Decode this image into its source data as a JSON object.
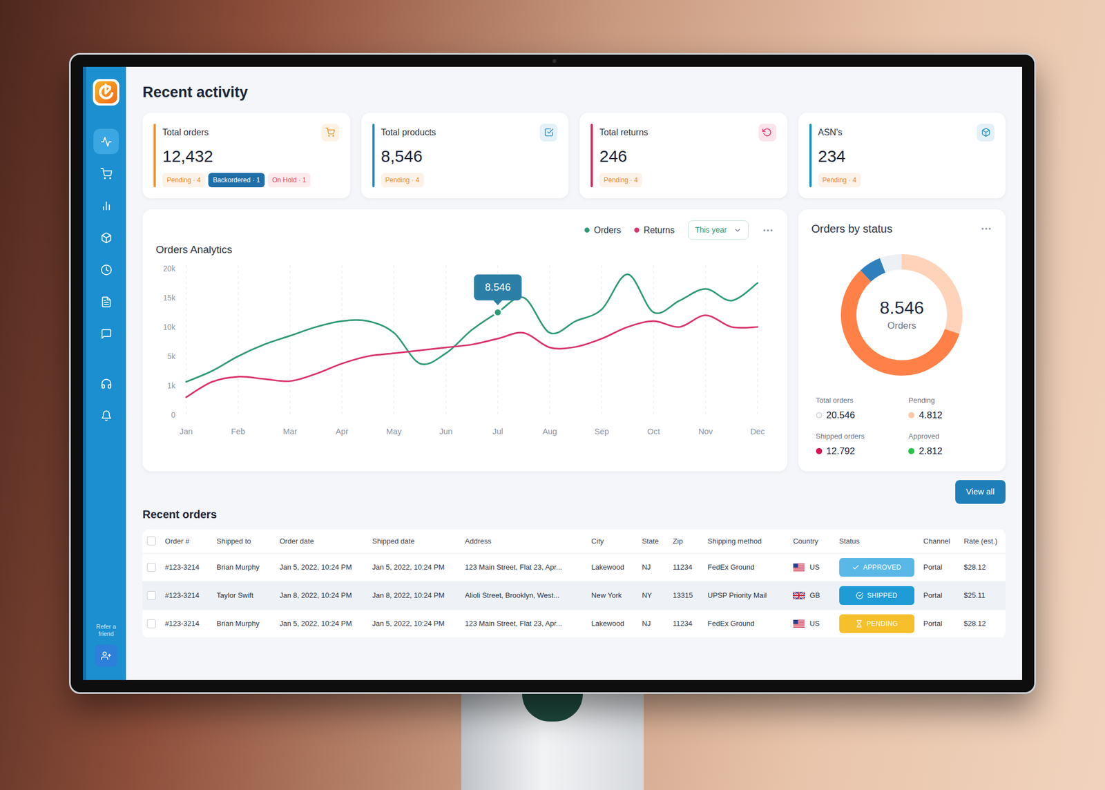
{
  "sidebar": {
    "items": [
      {
        "selected": true
      },
      {
        "selected": false
      },
      {
        "selected": false
      },
      {
        "selected": false
      },
      {
        "selected": false
      },
      {
        "selected": false
      },
      {
        "selected": false
      },
      {
        "selected": false
      },
      {
        "selected": false
      }
    ],
    "refer": "Refer a friend"
  },
  "page_title": "Recent activity",
  "stats": [
    {
      "label": "Total orders",
      "value": "12,432",
      "accent": "#f0912c",
      "badges": [
        {
          "label": "Pending · 4",
          "kind": "soft",
          "color": "#f08a2c"
        },
        {
          "label": "Backordered · 1",
          "kind": "solid",
          "color": "#1f6fa8"
        },
        {
          "label": "On Hold · 1",
          "kind": "soft",
          "color": "#e2465f"
        }
      ]
    },
    {
      "label": "Total products",
      "value": "8,546",
      "accent": "#1e8bc3",
      "badges": [
        {
          "label": "Pending · 4",
          "kind": "soft",
          "color": "#f08a2c"
        }
      ]
    },
    {
      "label": "Total returns",
      "value": "246",
      "accent": "#e0245e",
      "badges": [
        {
          "label": "Pending · 4",
          "kind": "soft",
          "color": "#f08a2c"
        }
      ]
    },
    {
      "label": "ASN's",
      "value": "234",
      "accent": "#1e8bc3",
      "badges": [
        {
          "label": "Pending · 4",
          "kind": "soft",
          "color": "#f08a2c"
        }
      ]
    }
  ],
  "chart": {
    "title": "Orders Analytics",
    "range": "This year",
    "y_ticks": [
      {
        "label": "20k",
        "value": 20000
      },
      {
        "label": "15k",
        "value": 15000
      },
      {
        "label": "10k",
        "value": 10000
      },
      {
        "label": "5k",
        "value": 5000
      },
      {
        "label": "1k",
        "value": 1000
      },
      {
        "label": "0",
        "value": 0
      }
    ],
    "x_ticks": [
      "Jan",
      "Feb",
      "Mar",
      "Apr",
      "May",
      "Jun",
      "Jul",
      "Aug",
      "Sep",
      "Oct",
      "Nov",
      "Dec"
    ],
    "series": [
      {
        "label": "Orders",
        "color": "#2f9a78",
        "values": [
          1500,
          3000,
          5000,
          7000,
          8500,
          10000,
          11000,
          11000,
          9000,
          4000,
          5500,
          9500,
          12500,
          15000,
          9000,
          11000,
          13000,
          19000,
          12500,
          14500,
          16500,
          14500,
          17500
        ]
      },
      {
        "label": "Returns",
        "color": "#d9336c",
        "values": [
          600,
          1500,
          2200,
          1900,
          1600,
          2600,
          4000,
          5000,
          5500,
          6000,
          6500,
          7000,
          8000,
          9000,
          6500,
          6600,
          8000,
          10000,
          11000,
          10000,
          12000,
          10000,
          10000
        ]
      }
    ],
    "tooltip": {
      "label": "8.546",
      "index": 12
    }
  },
  "status": {
    "title": "Orders by status",
    "total": "8.546",
    "total_label": "Orders",
    "segments": [
      {
        "share": 0.3,
        "color": "#ffd3ba"
      },
      {
        "share": 0.58,
        "color": "#ff8147"
      },
      {
        "share": 0.06,
        "color": "#2f7fbd"
      },
      {
        "share": 0.06,
        "color": "#edf0f4"
      }
    ],
    "legend": [
      {
        "label": "Total orders",
        "value": "20.546",
        "color": "#d4d9e0",
        "kind": "outline"
      },
      {
        "label": "Pending",
        "value": "4.812",
        "color": "#ffc9a8",
        "kind": "fill"
      },
      {
        "label": "Shipped orders",
        "value": "12.792",
        "color": "#d6134f",
        "kind": "fill"
      },
      {
        "label": "Approved",
        "value": "2.812",
        "color": "#27c24c",
        "kind": "fill"
      }
    ]
  },
  "view_all": "View all",
  "orders": {
    "title": "Recent orders",
    "header_checked": false,
    "columns": [
      "Order #",
      "Shipped to",
      "Order date",
      "Shipped date",
      "Address",
      "City",
      "State",
      "Zip",
      "Shipping method",
      "Country",
      "Status",
      "Channel",
      "Rate (est.)"
    ],
    "rows": [
      {
        "checked": false,
        "highlighted": false,
        "order": "#123-3214",
        "shipped_to": "Brian Murphy",
        "order_date": "Jan 5, 2022, 10:24 PM",
        "shipped_date": "Jan 5, 2022, 10:24 PM",
        "address": "123 Main Street, Flat 23, Apr...",
        "city": "Lakewood",
        "state": "NJ",
        "zip": "11234",
        "method": "FedEx Ground",
        "country": "US",
        "status": {
          "label": "APPROVED",
          "kind": "approved",
          "color": "#5ab8e6"
        },
        "channel": "Portal",
        "rate": "$28.12"
      },
      {
        "checked": false,
        "highlighted": true,
        "order": "#123-3214",
        "shipped_to": "Taylor Swift",
        "order_date": "Jan 8, 2022, 10:24 PM",
        "shipped_date": "Jan 8, 2022, 10:24 PM",
        "address": "Alioli Street, Brooklyn, West...",
        "city": "New York",
        "state": "NY",
        "zip": "13315",
        "method": "UPSP Priority Mail",
        "country": "GB",
        "status": {
          "label": "SHIPPED",
          "kind": "shipped",
          "color": "#1f9bd6"
        },
        "channel": "Portal",
        "rate": "$25.11"
      },
      {
        "checked": false,
        "highlighted": false,
        "order": "#123-3214",
        "shipped_to": "Brian Murphy",
        "order_date": "Jan 5, 2022, 10:24 PM",
        "shipped_date": "Jan 5, 2022, 10:24 PM",
        "address": "123 Main Street, Flat 23, Apr...",
        "city": "Lakewood",
        "state": "NJ",
        "zip": "11234",
        "method": "FedEx Ground",
        "country": "US",
        "status": {
          "label": "PENDING",
          "kind": "pending",
          "color": "#f6c02c"
        },
        "channel": "Portal",
        "rate": "$28.12"
      }
    ]
  }
}
